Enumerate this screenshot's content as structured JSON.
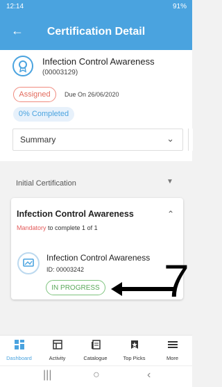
{
  "status_bar": {
    "time": "12:14",
    "battery": "91%"
  },
  "appbar": {
    "title": "Certification Detail",
    "back_icon": "arrow-left-icon"
  },
  "certification": {
    "title": "Infection Control Awareness",
    "code": "(00003129)",
    "status": "Assigned",
    "due": "Due On 26/06/2020",
    "progress_label": "0% Completed",
    "summary_label": "Summary"
  },
  "section": {
    "label": "Initial Certification"
  },
  "card": {
    "title": "Infection Control Awareness",
    "mandatory": "Mandatory",
    "mandatory_rest": " to complete 1 of 1",
    "item": {
      "title": "Infection Control Awareness",
      "id": "ID: 00003242",
      "status": "IN PROGRESS"
    }
  },
  "annotation": {
    "number": "7"
  },
  "bottom_nav": [
    {
      "label": "Dashboard",
      "icon": "dashboard-icon",
      "active": true
    },
    {
      "label": "Activity",
      "icon": "activity-icon"
    },
    {
      "label": "Catalogue",
      "icon": "catalogue-icon"
    },
    {
      "label": "Top Picks",
      "icon": "top-picks-icon"
    },
    {
      "label": "More",
      "icon": "menu-icon"
    }
  ],
  "colors": {
    "primary": "#4aa3df",
    "assigned": "#e36b5d",
    "in_progress": "#5aa85a",
    "mandatory": "#e35b5b"
  }
}
